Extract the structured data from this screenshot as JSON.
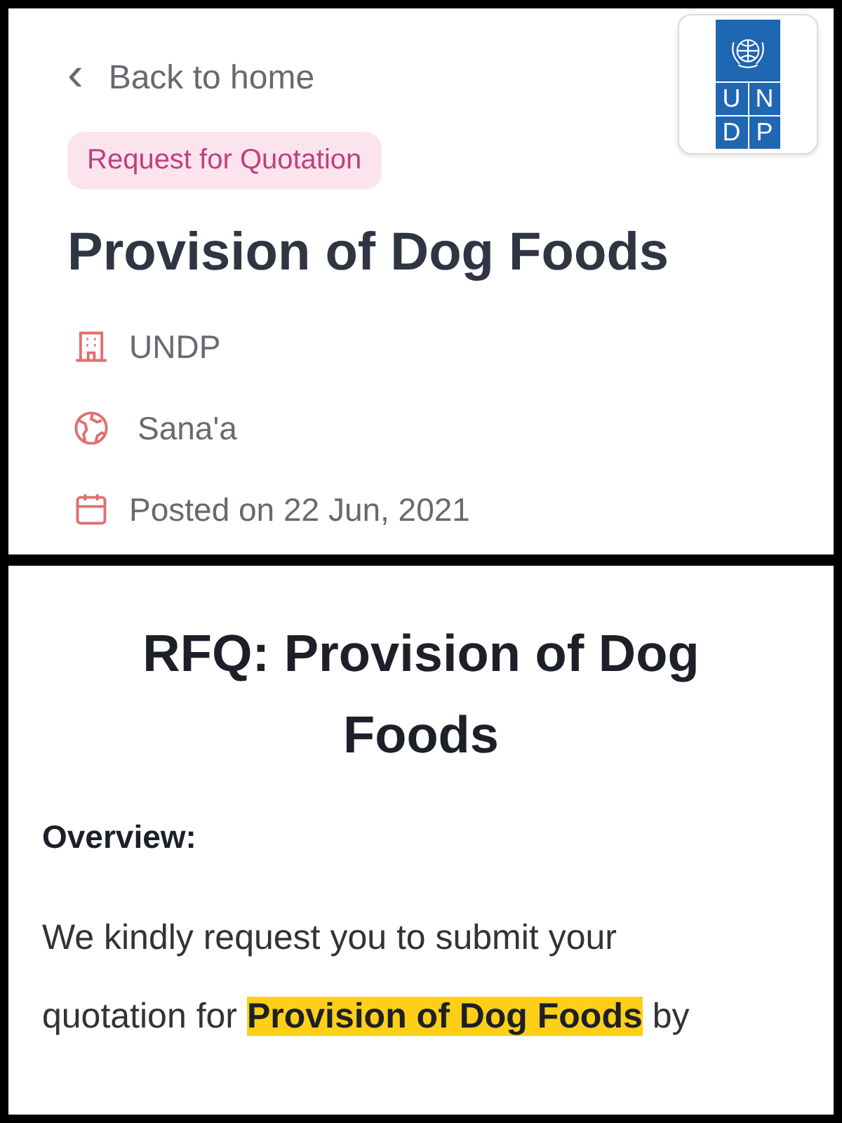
{
  "top_screen": {
    "back_link": {
      "icon": "‹",
      "label": "Back to home"
    },
    "logo": {
      "letters": [
        "U",
        "N",
        "D",
        "P"
      ]
    },
    "badge": "Request for Quotation",
    "title": "Provision of Dog Foods",
    "meta": [
      {
        "kind": "organization",
        "text": "UNDP"
      },
      {
        "kind": "location",
        "text": "Sana'a"
      },
      {
        "kind": "date",
        "text": "Posted on 22 Jun, 2021"
      }
    ]
  },
  "bottom_screen": {
    "heading": "RFQ: Provision of Dog Foods",
    "section_label": "Overview:",
    "paragraph": "We kindly request you to submit your quotation for **Provision of Dog Foods** by"
  }
}
